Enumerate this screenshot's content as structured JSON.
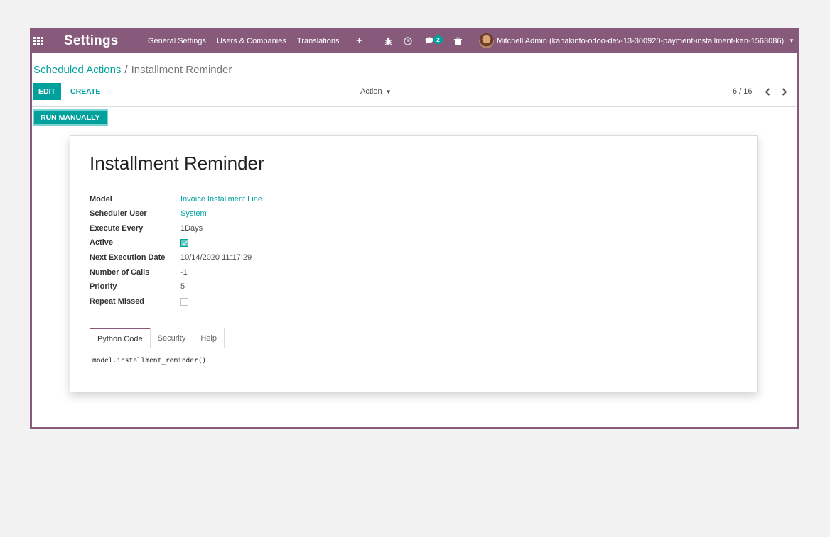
{
  "navbar": {
    "app_title": "Settings",
    "menu": [
      "General Settings",
      "Users & Companies",
      "Translations"
    ],
    "messages_count": "2",
    "user": "Mitchell Admin (kanakinfo-odoo-dev-13-300920-payment-installment-kan-1563086)"
  },
  "breadcrumb": {
    "parent": "Scheduled Actions",
    "separator": "/",
    "current": "Installment Reminder"
  },
  "toolbar": {
    "edit_label": "EDIT",
    "create_label": "CREATE",
    "action_label": "Action",
    "pager": "6 / 16"
  },
  "statusbar": {
    "run_label": "RUN MANUALLY"
  },
  "record": {
    "title": "Installment Reminder",
    "fields": [
      {
        "label": "Model",
        "value": "Invoice Installment Line"
      },
      {
        "label": "Scheduler User",
        "value": "System"
      },
      {
        "label": "Execute Every",
        "value": "1Days"
      },
      {
        "label": "Active",
        "checked": true
      },
      {
        "label": "Next Execution Date",
        "value": "10/14/2020 11:17:29"
      },
      {
        "label": "Number of Calls",
        "value": "-1"
      },
      {
        "label": "Priority",
        "value": "5"
      },
      {
        "label": "Repeat Missed",
        "checked": false
      }
    ]
  },
  "tabs": [
    "Python Code",
    "Security",
    "Help"
  ],
  "active_tab": "Python Code",
  "code": "model.installment_reminder()",
  "colors": {
    "brand": "#875a7b",
    "accent": "#00a09d"
  }
}
